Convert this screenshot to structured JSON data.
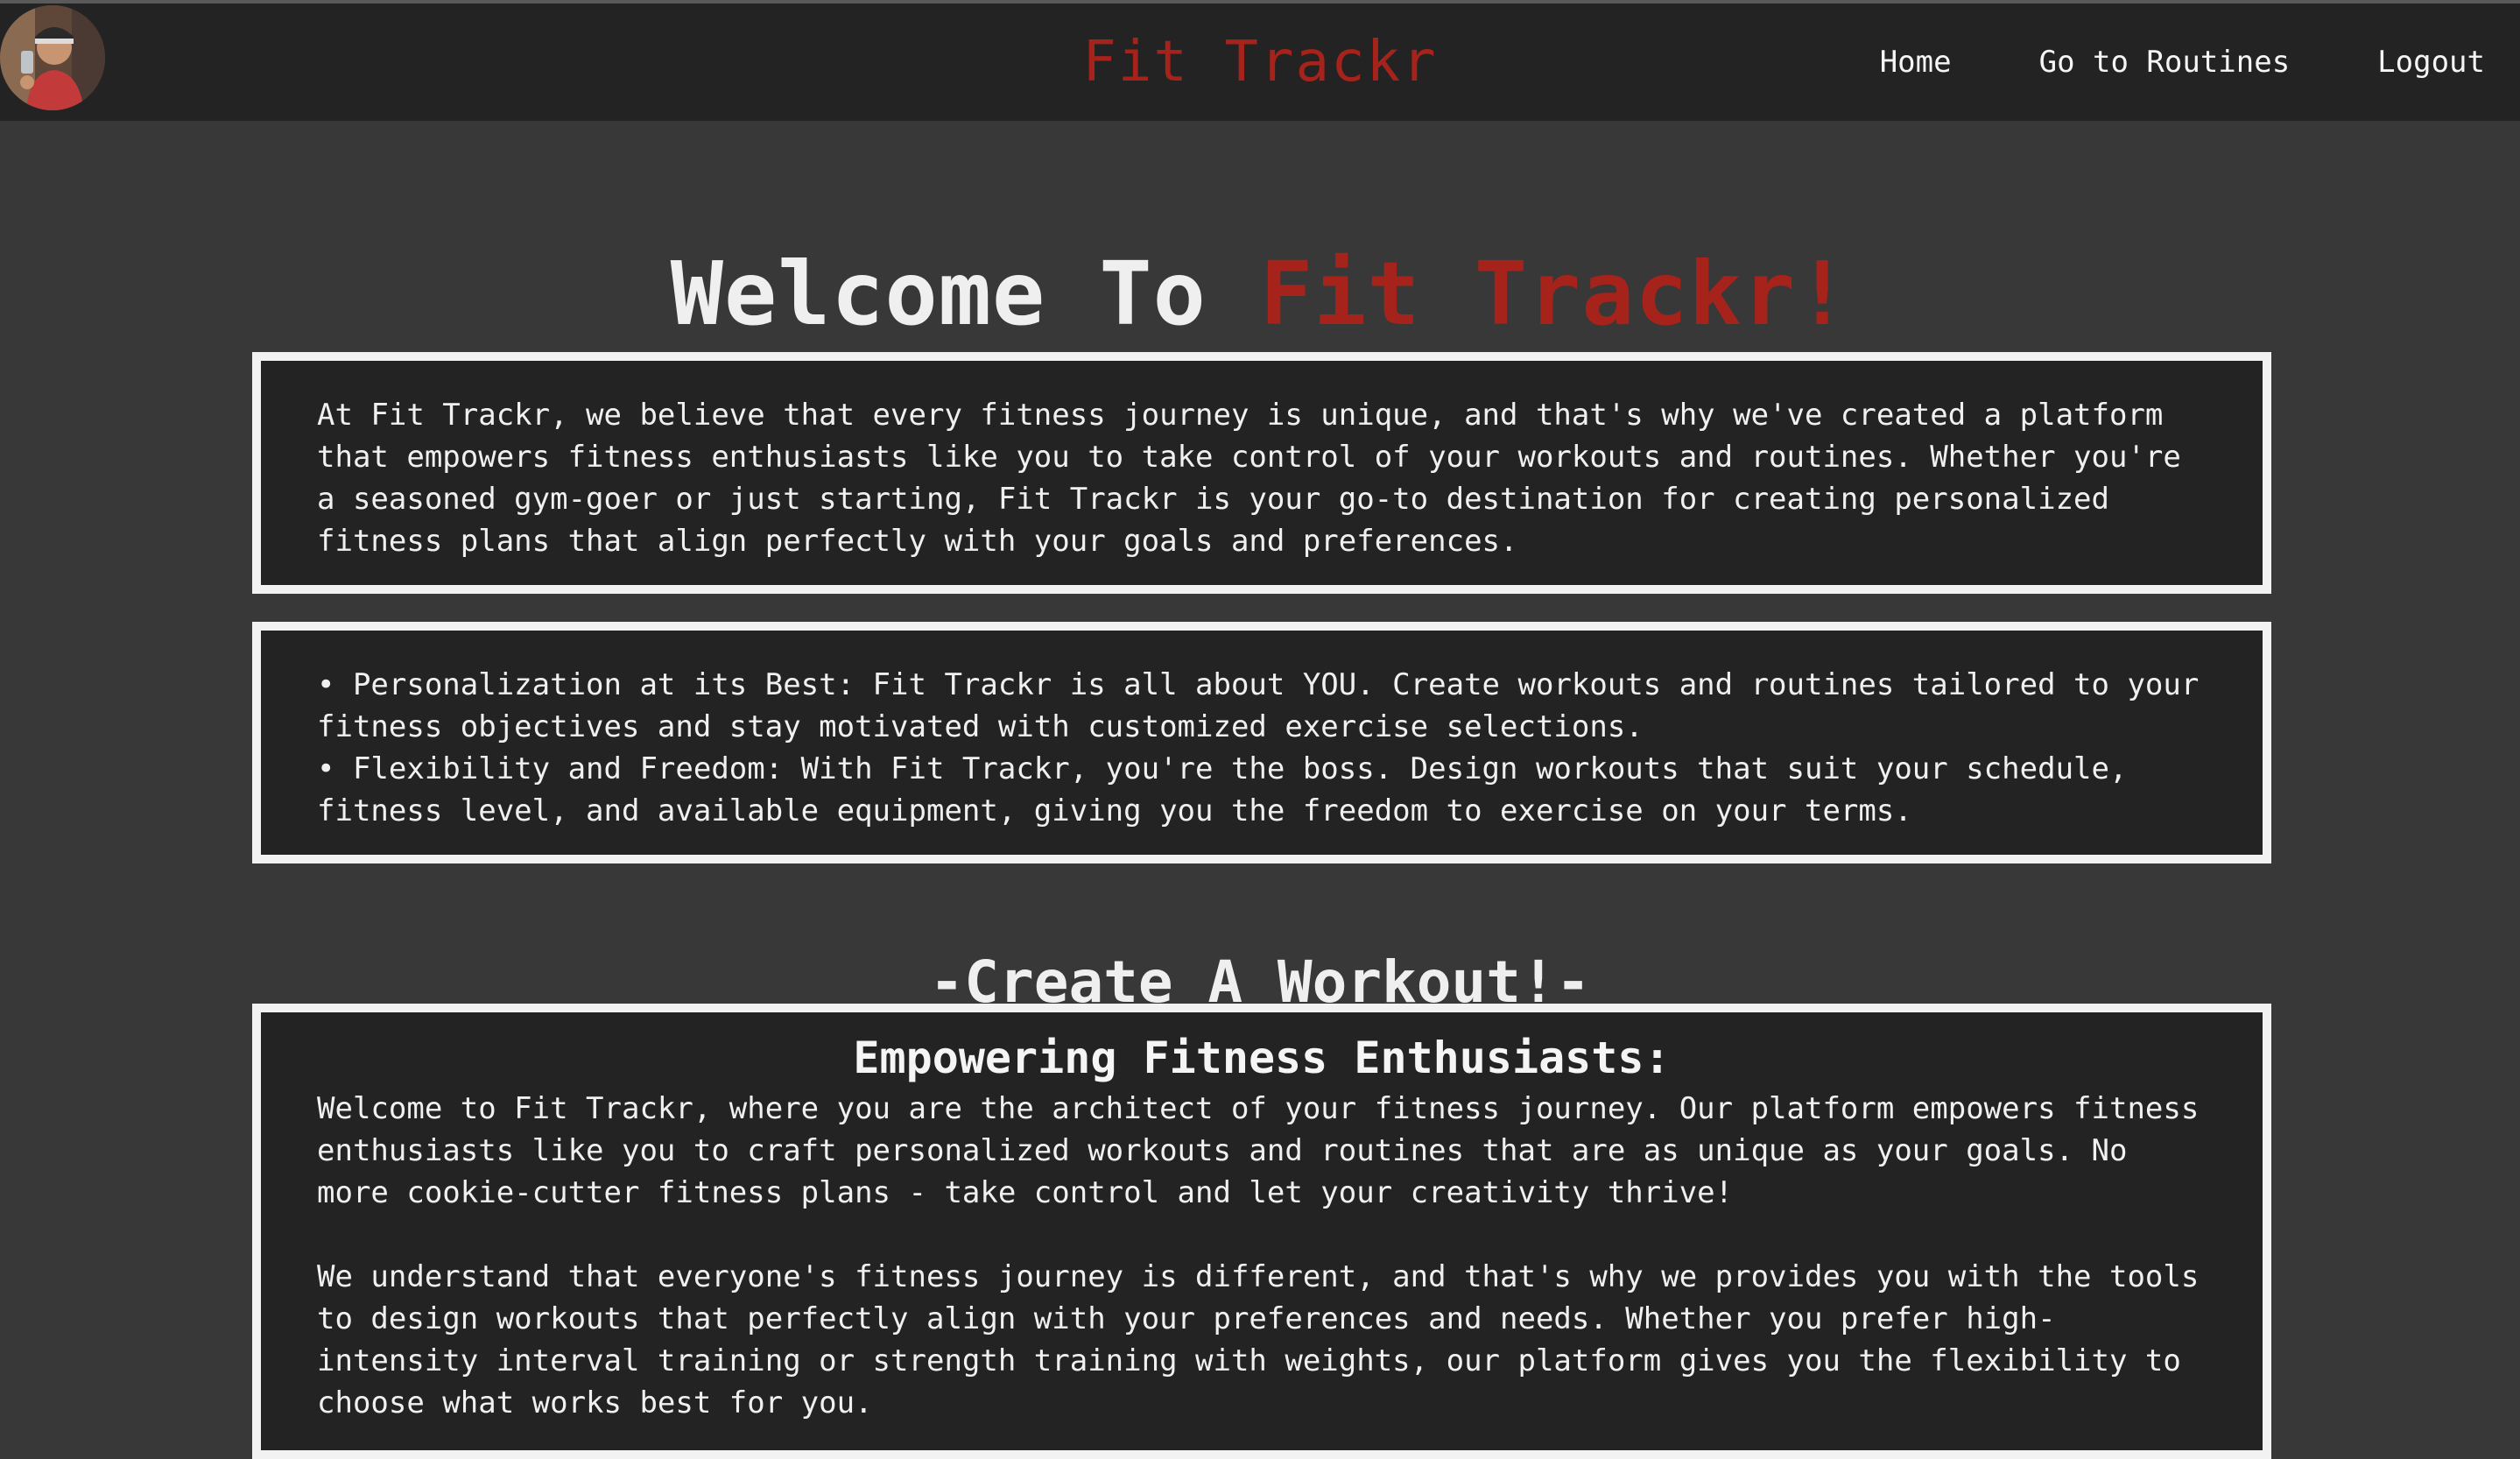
{
  "nav": {
    "brand": "Fit Trackr",
    "links": [
      "Home",
      "Go to Routines",
      "Logout"
    ]
  },
  "hero": {
    "title_prefix": "Welcome To ",
    "title_accent": "Fit Trackr!"
  },
  "intro": {
    "text": "At Fit Trackr, we believe that every fitness journey is unique, and that's why we've created a platform that empowers fitness enthusiasts like you to take control of your workouts and routines. Whether you're a seasoned gym-goer or just starting, Fit Trackr is your go-to destination for creating personalized fitness plans that align perfectly with your goals and preferences."
  },
  "features": {
    "items": [
      "• Personalization at its Best: Fit Trackr is all about YOU. Create workouts and routines tailored to your fitness objectives and stay motivated with customized exercise selections.",
      "• Flexibility and Freedom: With Fit Trackr, you're the boss. Design workouts that suit your schedule, fitness level, and available equipment, giving you the freedom to exercise on your terms."
    ]
  },
  "create": {
    "section_title": "-Create A Workout!-",
    "card_title": "Empowering Fitness Enthusiasts:",
    "paragraphs": [
      "Welcome to Fit Trackr, where you are the architect of your fitness journey. Our platform empowers fitness enthusiasts like you to craft personalized workouts and routines that are as unique as your goals. No more cookie-cutter fitness plans - take control and let your creativity thrive!",
      "We understand that everyone's fitness journey is different, and that's why we provides you with the tools to design workouts that perfectly align with your preferences and needs. Whether you prefer high-intensity interval training or strength training with weights, our platform gives you the flexibility to choose what works best for you."
    ]
  },
  "colors": {
    "accent": "#a5231b",
    "navbar": "#232323",
    "page": "#383838",
    "card": "#232323",
    "border": "#f2f2f2"
  },
  "icons": {
    "avatar": "user-avatar-photo"
  }
}
